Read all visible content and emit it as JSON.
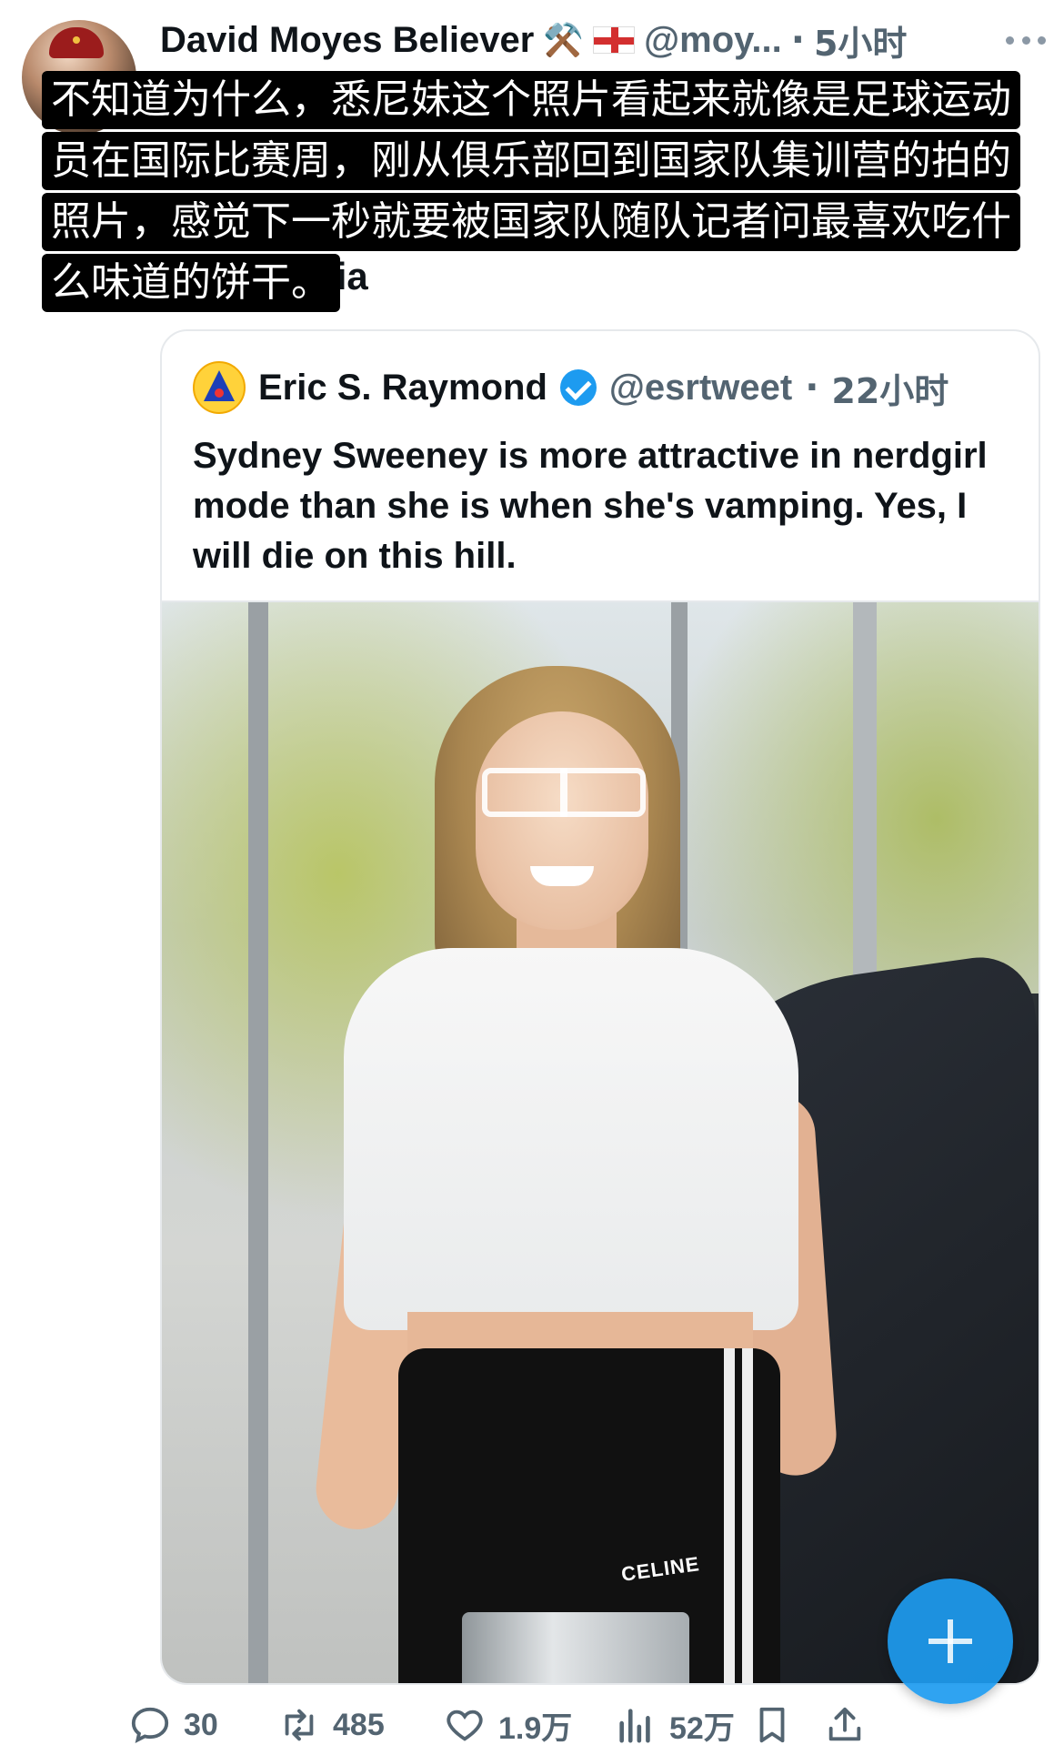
{
  "tweet": {
    "author": {
      "display_name": "David Moyes Believer",
      "emoji": "⚒️",
      "handle": "@moy...",
      "time": "5小时"
    },
    "text_visible": "ocial media",
    "caption_overlay": [
      "不知道为什么，悉尼妹这个照片看起来就像是足球运动",
      "员在国际比赛周，刚从俱乐部回到国家队集训营的拍的",
      "照片，感觉下一秒就要被国家队随队记者问最喜欢吃什",
      "么味道的饼干。"
    ]
  },
  "quoted_tweet": {
    "author": {
      "display_name": "Eric S. Raymond",
      "verified": true,
      "handle": "@esrtweet",
      "time": "22小时"
    },
    "text": "Sydney Sweeney is more attractive in nerdgirl mode than she is when she's vamping. Yes, I will die on this hill.",
    "photo": {
      "bag_logo_text": "CELINE"
    }
  },
  "actions": {
    "reply_count": "30",
    "retweet_count": "485",
    "like_count": "1.9万",
    "view_count": "52万"
  },
  "colors": {
    "accent": "#1d9bf0",
    "muted_text": "#536471",
    "primary_text": "#0f1419",
    "border": "#e6e9ec"
  },
  "icons": [
    "more-icon",
    "verified-icon",
    "reply-icon",
    "retweet-icon",
    "like-icon",
    "views-icon",
    "bookmark-icon",
    "share-icon",
    "plus-icon"
  ]
}
